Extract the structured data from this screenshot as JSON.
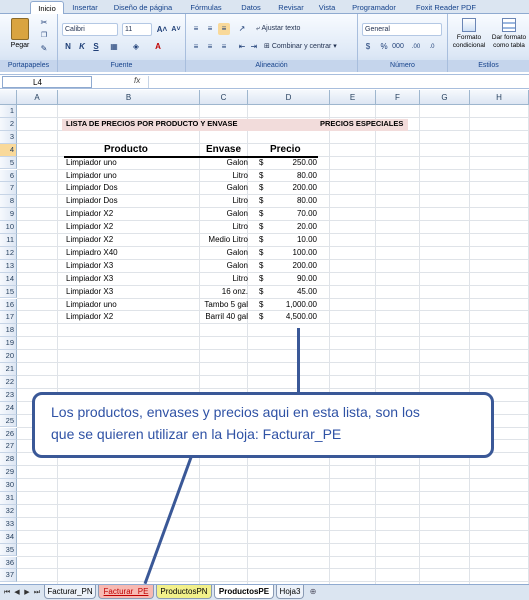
{
  "ribbon_tabs": [
    "Inicio",
    "Insertar",
    "Diseño de página",
    "Fórmulas",
    "Datos",
    "Revisar",
    "Vista",
    "Programador",
    "Foxit Reader PDF"
  ],
  "ribbon": {
    "paste_label": "Pegar",
    "clipboard_group": "Portapapeles",
    "font_name": "Calibri",
    "font_size": "11",
    "font_group": "Fuente",
    "bold": "N",
    "italic": "K",
    "underline": "S",
    "wrap_text": "Ajustar texto",
    "merge_center": "Combinar y centrar",
    "alignment_group": "Alineación",
    "number_format": "General",
    "number_group": "Número",
    "conditional_format": "Formato condicional",
    "table_format": "Dar formato como tabla",
    "styles_group": "Estilos"
  },
  "formula_bar": {
    "name_box": "L4",
    "fx": "fx",
    "formula": ""
  },
  "columns": [
    "A",
    "B",
    "C",
    "D",
    "E",
    "F",
    "G",
    "H"
  ],
  "rows": [
    "1",
    "2",
    "3",
    "4",
    "5",
    "6",
    "7",
    "8",
    "9",
    "10",
    "11",
    "12",
    "13",
    "14",
    "15",
    "16",
    "17",
    "18",
    "19",
    "20",
    "21",
    "22",
    "23",
    "24",
    "25",
    "26",
    "27",
    "28",
    "29",
    "30",
    "31",
    "32",
    "33",
    "34",
    "35",
    "36",
    "37"
  ],
  "sheet": {
    "title": "LISTA DE PRECIOS POR PRODUCTO Y ENVASE",
    "subtitle": "PRECIOS ESPECIALES",
    "headers": {
      "product": "Producto",
      "package": "Envase",
      "price": "Precio"
    },
    "currency": "$",
    "items": [
      {
        "product": "Limpiador uno",
        "package": "Galon",
        "price": "250.00"
      },
      {
        "product": "Limpiador uno",
        "package": "Litro",
        "price": "80.00"
      },
      {
        "product": "Limpiador Dos",
        "package": "Galon",
        "price": "200.00"
      },
      {
        "product": "Limpiador Dos",
        "package": "Litro",
        "price": "80.00"
      },
      {
        "product": "Limpiador X2",
        "package": "Galon",
        "price": "70.00"
      },
      {
        "product": "Limpiador X2",
        "package": "Litro",
        "price": "20.00"
      },
      {
        "product": "Limpiador X2",
        "package": "Medio Litro",
        "price": "10.00"
      },
      {
        "product": "Limpiadro X40",
        "package": "Galon",
        "price": "100.00"
      },
      {
        "product": "Limpiador X3",
        "package": "Galon",
        "price": "200.00"
      },
      {
        "product": "Limpiador X3",
        "package": "Litro",
        "price": "90.00"
      },
      {
        "product": "Limpiador X3",
        "package": "16 onz.",
        "price": "45.00"
      },
      {
        "product": "Limpiador uno",
        "package": "Tambo 5 gal",
        "price": "1,000.00"
      },
      {
        "product": "Limpiador X2",
        "package": "Barril 40 gal",
        "price": "4,500.00"
      }
    ]
  },
  "callout": {
    "line1": "Los productos, envases y precios aqui en esta lista, son los",
    "line2": "que se quieren utilizar en la Hoja: Facturar_PE"
  },
  "sheet_tabs": [
    {
      "label": "Facturar_PN",
      "color": "#edf2f9",
      "text_color": "#000000"
    },
    {
      "label": "Facturar_PE",
      "color": "#f7b9b2",
      "text_color": "#c00000"
    },
    {
      "label": "ProductosPN",
      "color": "#f2f08a",
      "text_color": "#000000"
    },
    {
      "label": "ProductosPE",
      "color": "#ffffff",
      "text_color": "#000000"
    },
    {
      "label": "Hoja3",
      "color": "#edf2f9",
      "text_color": "#000000"
    }
  ],
  "colors": {
    "accent": "#3a5897",
    "header_fill": "#f2dcdb"
  }
}
